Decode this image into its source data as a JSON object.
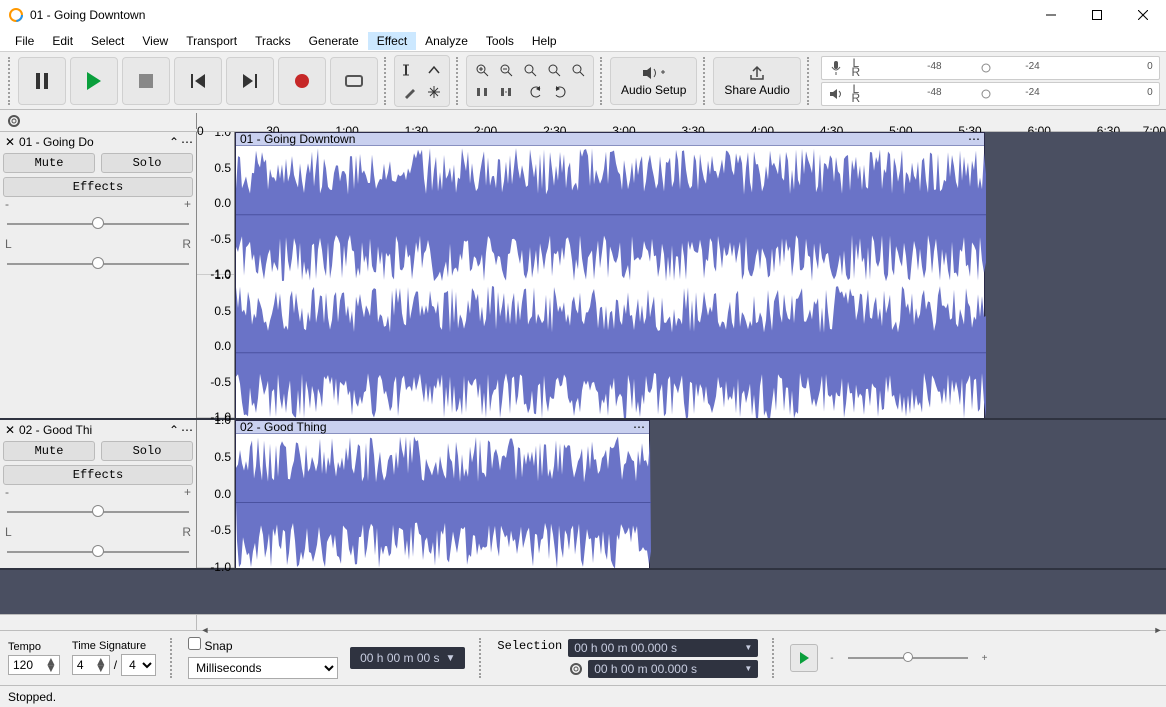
{
  "window": {
    "title": "01 - Going Downtown"
  },
  "menu": [
    "File",
    "Edit",
    "Select",
    "View",
    "Transport",
    "Tracks",
    "Generate",
    "Effect",
    "Analyze",
    "Tools",
    "Help"
  ],
  "menu_highlight": "Effect",
  "toolbar": {
    "audio_setup": "Audio Setup",
    "share_audio": "Share Audio"
  },
  "meter": {
    "channels": [
      "L",
      "R"
    ],
    "ticks": [
      "-48",
      "-24",
      "0"
    ]
  },
  "timeline": [
    "0",
    "30",
    "1:00",
    "1:30",
    "2:00",
    "2:30",
    "3:00",
    "3:30",
    "4:00",
    "4:30",
    "5:00",
    "5:30",
    "6:00",
    "6:30",
    "7:00"
  ],
  "amp_scale": [
    "1.0",
    "0.5",
    "0.0",
    "-0.5",
    "-1.0"
  ],
  "tracks": [
    {
      "name_full": "01 - Going Downtown",
      "name_short": "01 - Going Do",
      "mute": "Mute",
      "solo": "Solo",
      "effects": "Effects",
      "gain_ends": [
        "-",
        "+"
      ],
      "pan_ends": [
        "L",
        "R"
      ],
      "channels": 2,
      "clip_width": 750
    },
    {
      "name_full": "02 - Good Thing",
      "name_short": "02 - Good Thi",
      "mute": "Mute",
      "solo": "Solo",
      "effects": "Effects",
      "gain_ends": [
        "-",
        "+"
      ],
      "pan_ends": [
        "L",
        "R"
      ],
      "channels": 1,
      "clip_width": 415
    }
  ],
  "bottom": {
    "tempo_label": "Tempo",
    "tempo_value": "120",
    "ts_label": "Time Signature",
    "ts_num": "4",
    "ts_sep": "/",
    "ts_den": "4",
    "snap_label": "Snap",
    "snap_unit": "Milliseconds",
    "timecode": "00 h 00 m 00 s",
    "selection_label": "Selection",
    "sel_start": "00 h 00 m 00.000 s",
    "sel_end": "00 h 00 m 00.000 s",
    "zoom_ends": [
      "-",
      "+"
    ]
  },
  "status": "Stopped."
}
